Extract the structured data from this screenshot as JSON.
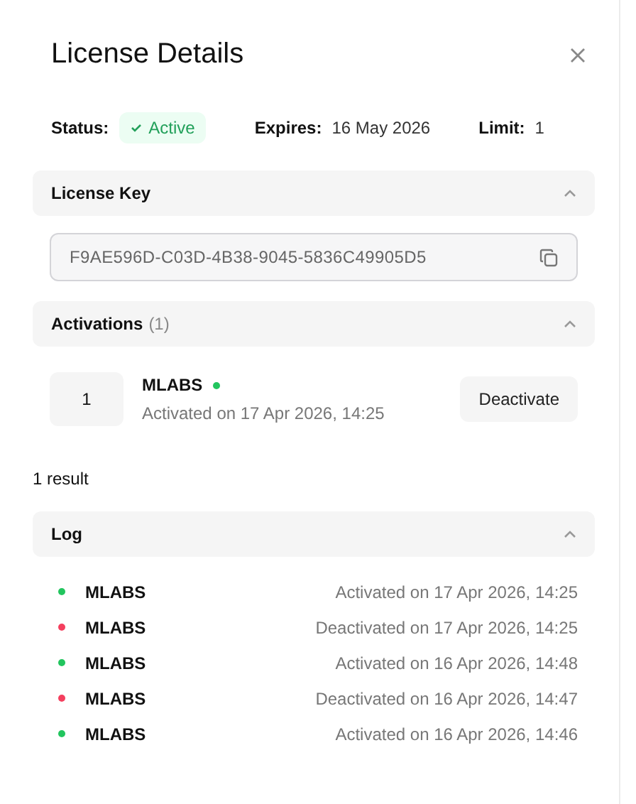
{
  "title": "License Details",
  "meta": [
    {
      "label": "Status:",
      "value": "Active",
      "kind": "badge"
    },
    {
      "label": "Expires:",
      "value": "16 May 2026",
      "kind": "text"
    },
    {
      "label": "Limit:",
      "value": "1",
      "kind": "text"
    }
  ],
  "license_key": {
    "title": "License Key",
    "expanded": true,
    "value": "F9AE596D-C03D-4B38-9045-5836C49905D5"
  },
  "activations": {
    "title": "Activations",
    "count": "(1)",
    "expanded": true,
    "items": [
      {
        "number": "1",
        "name": "MLABS",
        "color": "#22c55e",
        "detail": "Activated on 17 Apr 2026, 14:25",
        "action": "Deactivate"
      }
    ],
    "result_count": "1 result"
  },
  "log": {
    "title": "Log",
    "expanded": true,
    "entries": [
      {
        "name": "MLABS",
        "color": "#22c55e",
        "event": "Activated on 17 Apr 2026, 14:25"
      },
      {
        "name": "MLABS",
        "color": "#f43f5e",
        "event": "Deactivated on 17 Apr 2026, 14:25"
      },
      {
        "name": "MLABS",
        "color": "#22c55e",
        "event": "Activated on 16 Apr 2026, 14:48"
      },
      {
        "name": "MLABS",
        "color": "#f43f5e",
        "event": "Deactivated on 16 Apr 2026, 14:47"
      },
      {
        "name": "MLABS",
        "color": "#22c55e",
        "event": "Activated on 16 Apr 2026, 14:46"
      }
    ]
  }
}
